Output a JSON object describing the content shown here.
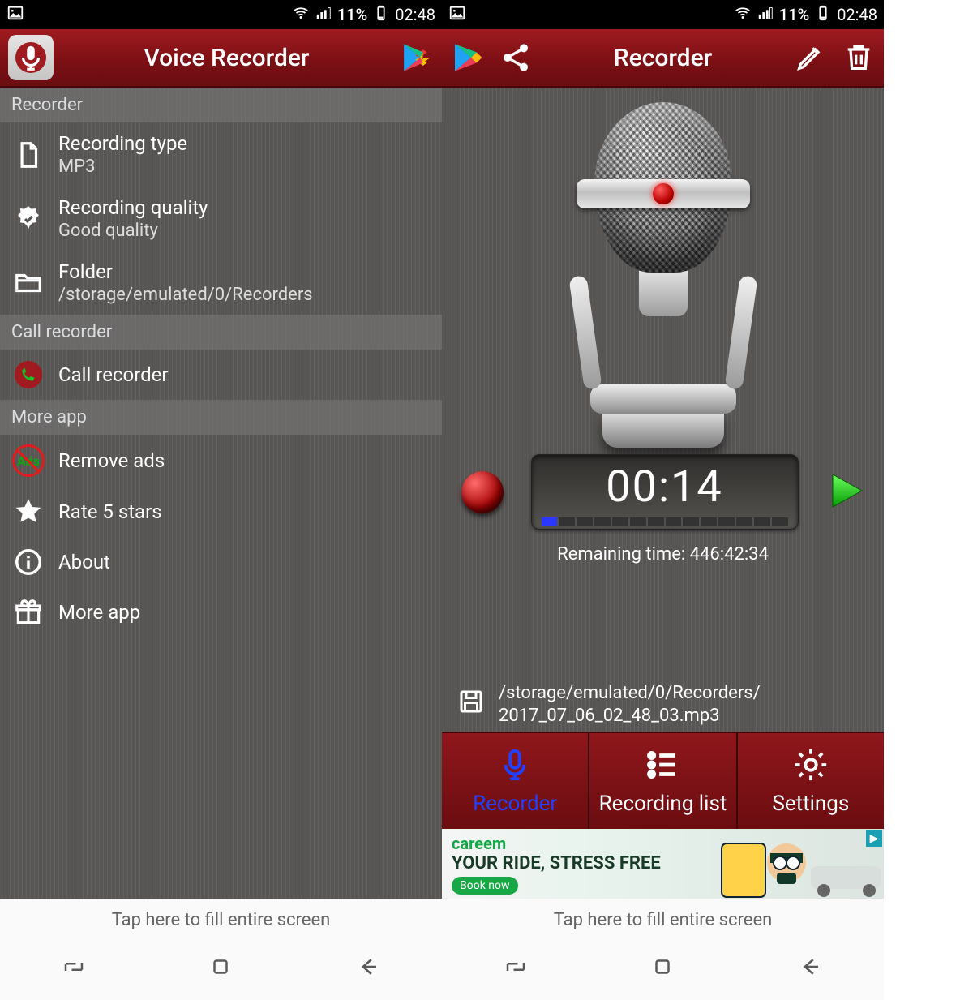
{
  "status": {
    "battery_pct": "11%",
    "time": "02:48"
  },
  "left": {
    "header": {
      "title": "Voice Recorder"
    },
    "sections": {
      "recorder_label": "Recorder",
      "call_label": "Call recorder",
      "more_label": "More app"
    },
    "items": {
      "type": {
        "title": "Recording type",
        "sub": "MP3"
      },
      "quality": {
        "title": "Recording quality",
        "sub": "Good quality"
      },
      "folder": {
        "title": "Folder",
        "sub": "/storage/emulated/0/Recorders"
      },
      "callrec": {
        "title": "Call recorder"
      },
      "remove_ads": {
        "title": "Remove ads"
      },
      "rate": {
        "title": "Rate 5 stars"
      },
      "about": {
        "title": "About"
      },
      "moreapp": {
        "title": "More app"
      }
    }
  },
  "right": {
    "header": {
      "title": "Recorder"
    },
    "timer": "00:14",
    "remaining_label": "Remaining time: 446:42:34",
    "save_path_line1": "/storage/emulated/0/Recorders/",
    "save_path_line2": "2017_07_06_02_48_03.mp3",
    "tabs": {
      "recorder": "Recorder",
      "list": "Recording list",
      "settings": "Settings"
    },
    "ad": {
      "brand": "careem",
      "line": "YOUR RIDE, STRESS FREE",
      "book": "Book now"
    }
  },
  "footer_hint": "Tap here to fill entire screen"
}
